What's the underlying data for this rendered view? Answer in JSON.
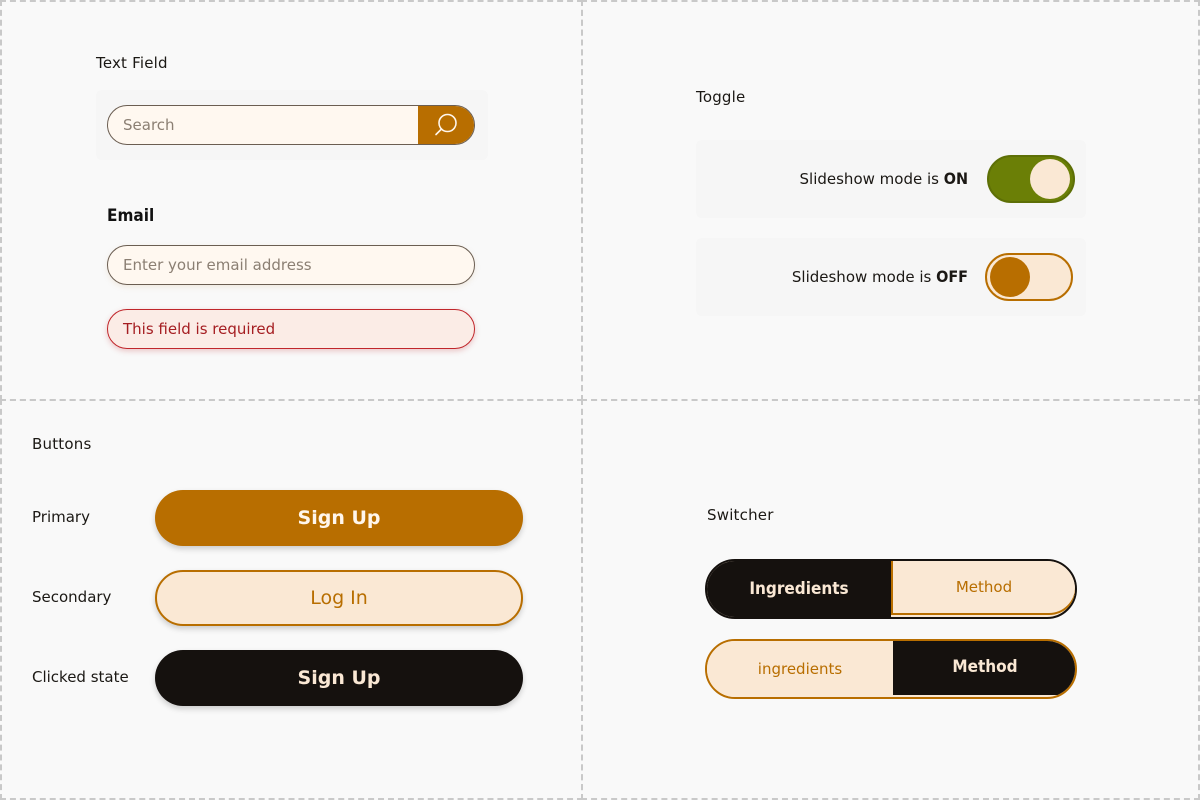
{
  "text_field": {
    "section_label": "Text Field",
    "search_placeholder": "Search",
    "email_label": "Email",
    "email_placeholder": "Enter your email address",
    "error_text": "This field is required"
  },
  "toggle": {
    "section_label": "Toggle",
    "on_row": {
      "prefix": "Slideshow mode is ",
      "state": "ON"
    },
    "off_row": {
      "prefix": "Slideshow mode is ",
      "state": "OFF"
    }
  },
  "buttons": {
    "section_label": "Buttons",
    "primary": {
      "row_label": "Primary",
      "label": "Sign Up"
    },
    "secondary": {
      "row_label": "Secondary",
      "label": "Log In"
    },
    "clicked": {
      "row_label": "Clicked state",
      "label": "Sign Up"
    }
  },
  "switcher": {
    "section_label": "Switcher",
    "first": {
      "left": "Ingredients",
      "right": "Method",
      "active": "left"
    },
    "second": {
      "left": "ingredients",
      "right": "Method",
      "active": "right"
    }
  },
  "colors": {
    "accent": "#b86e00",
    "cream": "#fae8d4",
    "dark": "#15110e",
    "olive": "#6b7f06",
    "error": "#c0262b"
  },
  "icons": {
    "search": "search-icon"
  }
}
